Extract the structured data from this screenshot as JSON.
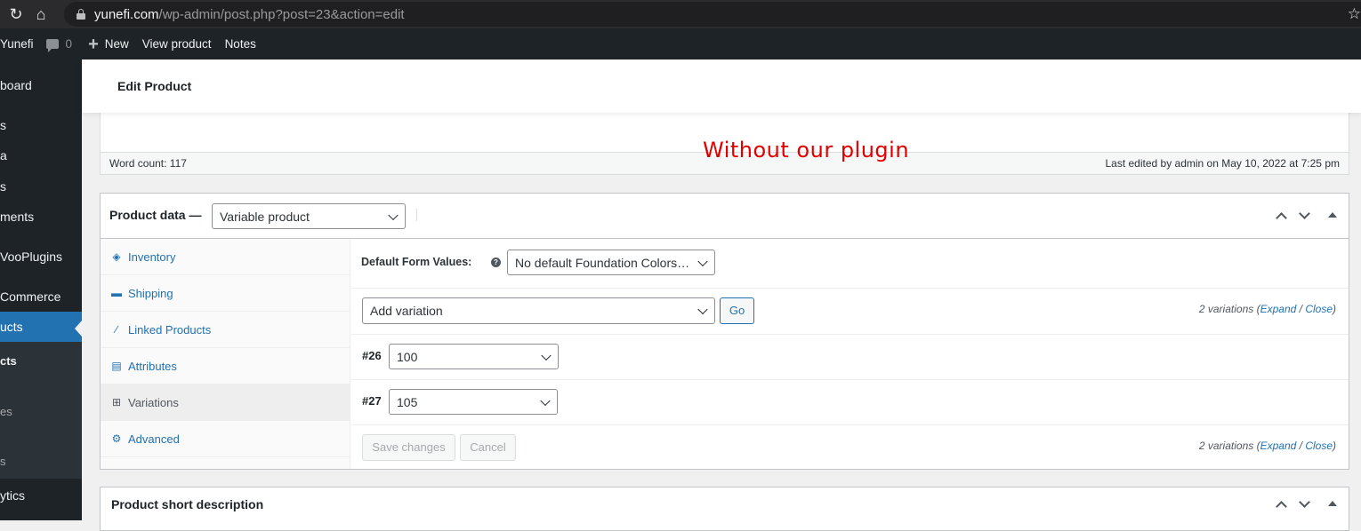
{
  "browser": {
    "url_host": "yunefi.com",
    "url_path": "/wp-admin/post.php?post=23&action=edit"
  },
  "admin_bar": {
    "site": "Yunefi",
    "comments_count": "0",
    "new_label": "New",
    "view_product": "View product",
    "notes": "Notes"
  },
  "side_menu": [
    {
      "label": "board"
    },
    {
      "label": "s"
    },
    {
      "label": "a"
    },
    {
      "label": "s"
    },
    {
      "label": "ments"
    },
    {
      "label": "VooPlugins"
    },
    {
      "label": "Commerce"
    },
    {
      "label": "ucts"
    },
    {
      "label": "cts"
    },
    {
      "label": "es"
    },
    {
      "label": "s"
    },
    {
      "label": "ytics"
    }
  ],
  "header": {
    "title": "Edit Product"
  },
  "editor": {
    "word_count": "Word count: 117",
    "last_edited": "Last edited by admin on May 10, 2022 at 7:25 pm"
  },
  "annotation": "Without our plugin",
  "product_data": {
    "title": "Product data —",
    "type_value": "Variable product",
    "tabs": [
      {
        "label": "Inventory",
        "icon": "tag-icon"
      },
      {
        "label": "Shipping",
        "icon": "truck-icon"
      },
      {
        "label": "Linked Products",
        "icon": "link-icon"
      },
      {
        "label": "Attributes",
        "icon": "list-icon"
      },
      {
        "label": "Variations",
        "icon": "grid-icon"
      },
      {
        "label": "Advanced",
        "icon": "gear-icon"
      }
    ],
    "active_tab": "Variations",
    "default_form_label": "Default Form Values:",
    "default_form_value": "No default Foundation Colors…",
    "add_variation_value": "Add variation",
    "go_label": "Go",
    "variations_count": "2 variations",
    "expand_label": "Expand",
    "close_label": "Close",
    "variations": [
      {
        "id": "#26",
        "value": "100"
      },
      {
        "id": "#27",
        "value": "105"
      }
    ],
    "save_label": "Save changes",
    "cancel_label": "Cancel"
  },
  "short_description": {
    "title": "Product short description"
  },
  "colors": {
    "admin_dark": "#1d2327",
    "accent": "#2271b1",
    "annotation": "#e10000"
  }
}
